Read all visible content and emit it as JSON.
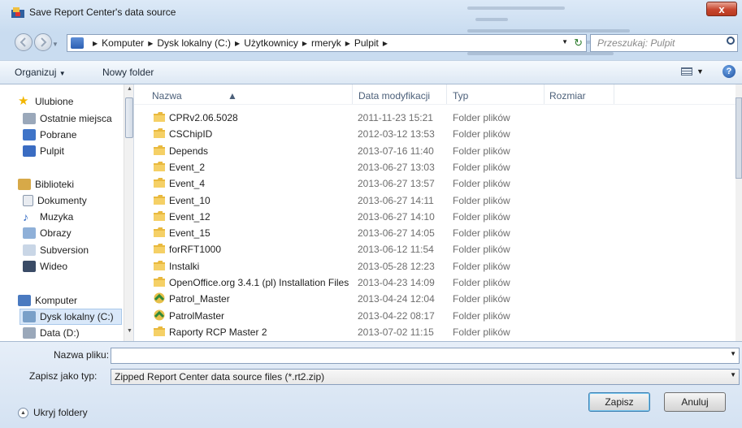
{
  "window": {
    "title": "Save Report Center's data source",
    "close_label": "x"
  },
  "address": {
    "crumbs": [
      "Komputer",
      "Dysk lokalny (C:)",
      "Użytkownicy",
      "rmeryk",
      "Pulpit"
    ],
    "search_placeholder": "Przeszukaj: Pulpit"
  },
  "toolbar": {
    "organize": "Organizuj",
    "new_folder": "Nowy folder"
  },
  "nav": {
    "items": [
      {
        "label": "Ulubione",
        "icon": "star-icon"
      },
      {
        "label": "Ostatnie miejsca",
        "icon": "recent-places-icon"
      },
      {
        "label": "Pobrane",
        "icon": "downloads-icon"
      },
      {
        "label": "Pulpit",
        "icon": "desktop-icon"
      },
      {
        "label": "Biblioteki",
        "icon": "libraries-icon"
      },
      {
        "label": "Dokumenty",
        "icon": "documents-icon"
      },
      {
        "label": "Muzyka",
        "icon": "music-icon"
      },
      {
        "label": "Obrazy",
        "icon": "pictures-icon"
      },
      {
        "label": "Subversion",
        "icon": "subversion-icon"
      },
      {
        "label": "Wideo",
        "icon": "video-icon"
      },
      {
        "label": "Komputer",
        "icon": "computer-icon"
      },
      {
        "label": "Dysk lokalny (C:)",
        "icon": "local-disk-icon"
      },
      {
        "label": "Data (D:)",
        "icon": "drive-icon"
      }
    ]
  },
  "columns": {
    "name": "Nazwa",
    "date": "Data modyfikacji",
    "type": "Typ",
    "size": "Rozmiar"
  },
  "files": [
    {
      "name": "CPRv2.06.5028",
      "date": "2011-11-23 15:21",
      "type": "Folder plików",
      "icon": "folder-icon"
    },
    {
      "name": "CSChipID",
      "date": "2012-03-12 13:53",
      "type": "Folder plików",
      "icon": "folder-icon"
    },
    {
      "name": "Depends",
      "date": "2013-07-16 11:40",
      "type": "Folder plików",
      "icon": "folder-icon"
    },
    {
      "name": "Event_2",
      "date": "2013-06-27 13:03",
      "type": "Folder plików",
      "icon": "folder-icon"
    },
    {
      "name": "Event_4",
      "date": "2013-06-27 13:57",
      "type": "Folder plików",
      "icon": "folder-icon"
    },
    {
      "name": "Event_10",
      "date": "2013-06-27 14:11",
      "type": "Folder plików",
      "icon": "folder-icon"
    },
    {
      "name": "Event_12",
      "date": "2013-06-27 14:10",
      "type": "Folder plików",
      "icon": "folder-icon"
    },
    {
      "name": "Event_15",
      "date": "2013-06-27 14:05",
      "type": "Folder plików",
      "icon": "folder-icon"
    },
    {
      "name": "forRFT1000",
      "date": "2013-06-12 11:54",
      "type": "Folder plików",
      "icon": "folder-icon"
    },
    {
      "name": "Instalki",
      "date": "2013-05-28 12:23",
      "type": "Folder plików",
      "icon": "folder-icon"
    },
    {
      "name": "OpenOffice.org 3.4.1 (pl) Installation Files",
      "date": "2013-04-23 14:09",
      "type": "Folder plików",
      "icon": "folder-icon"
    },
    {
      "name": "Patrol_Master",
      "date": "2013-04-24 12:04",
      "type": "Folder plików",
      "icon": "shortcut-folder-icon"
    },
    {
      "name": "PatrolMaster",
      "date": "2013-04-22 08:17",
      "type": "Folder plików",
      "icon": "shortcut-folder-icon"
    },
    {
      "name": "Raporty RCP Master 2",
      "date": "2013-07-02 11:15",
      "type": "Folder plików",
      "icon": "folder-icon"
    }
  ],
  "form": {
    "filename_label": "Nazwa pliku:",
    "filename_value": "",
    "filetype_label": "Zapisz jako typ:",
    "filetype_value": "Zipped Report Center data source files (*.rt2.zip)"
  },
  "footer": {
    "hide_folders": "Ukryj foldery",
    "save": "Zapisz",
    "cancel": "Anuluj"
  }
}
